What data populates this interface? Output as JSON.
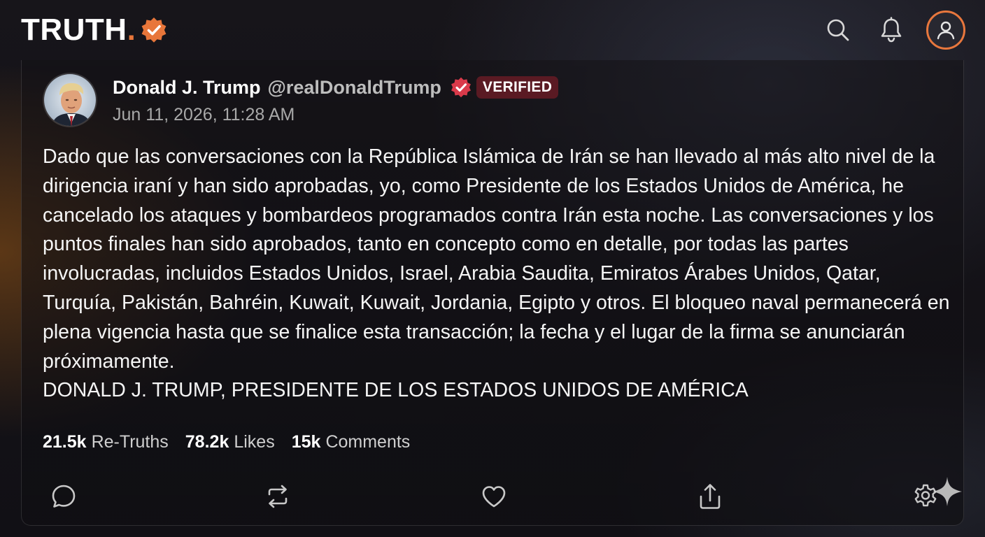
{
  "header": {
    "brand_word": "TRUTH",
    "brand_dot": ".",
    "icons": [
      "verified-badge-icon",
      "search-icon",
      "bell-icon",
      "user-icon"
    ]
  },
  "colors": {
    "accent": "#e8763a",
    "verified_pill_bg": "#5a1a23",
    "badge_red": "#d93a4a"
  },
  "post": {
    "author_name": "Donald J. Trump",
    "author_handle": "@realDonaldTrump",
    "verified_label": "VERIFIED",
    "timestamp": "Jun 11, 2026, 11:28 AM",
    "body": "Dado que las conversaciones con la República Islámica de Irán se han llevado al más alto nivel de la dirigencia iraní y han sido aprobadas, yo, como Presidente de los Estados Unidos de América, he cancelado los ataques y bombardeos programados contra Irán esta noche. Las conversaciones y los puntos finales han sido aprobados, tanto en concepto como en detalle, por todas las partes involucradas, incluidos Estados Unidos, Israel, Arabia Saudita, Emiratos Árabes Unidos, Qatar, Turquía, Pakistán, Bahréin, Kuwait, Kuwait, Jordania, Egipto y otros. El bloqueo naval permanecerá en plena vigencia hasta que se finalice esta transacción; la fecha y el lugar de la firma se anunciarán próximamente.\nDONALD J. TRUMP, PRESIDENTE DE LOS ESTADOS UNIDOS DE AMÉRICA",
    "stats": {
      "retruths_count": "21.5k",
      "retruths_label": "Re-Truths",
      "likes_count": "78.2k",
      "likes_label": "Likes",
      "comments_count": "15k",
      "comments_label": "Comments"
    },
    "action_icons": [
      "comment-icon",
      "retruth-icon",
      "heart-icon",
      "share-icon",
      "gear-icon",
      "sparkle-icon"
    ]
  }
}
